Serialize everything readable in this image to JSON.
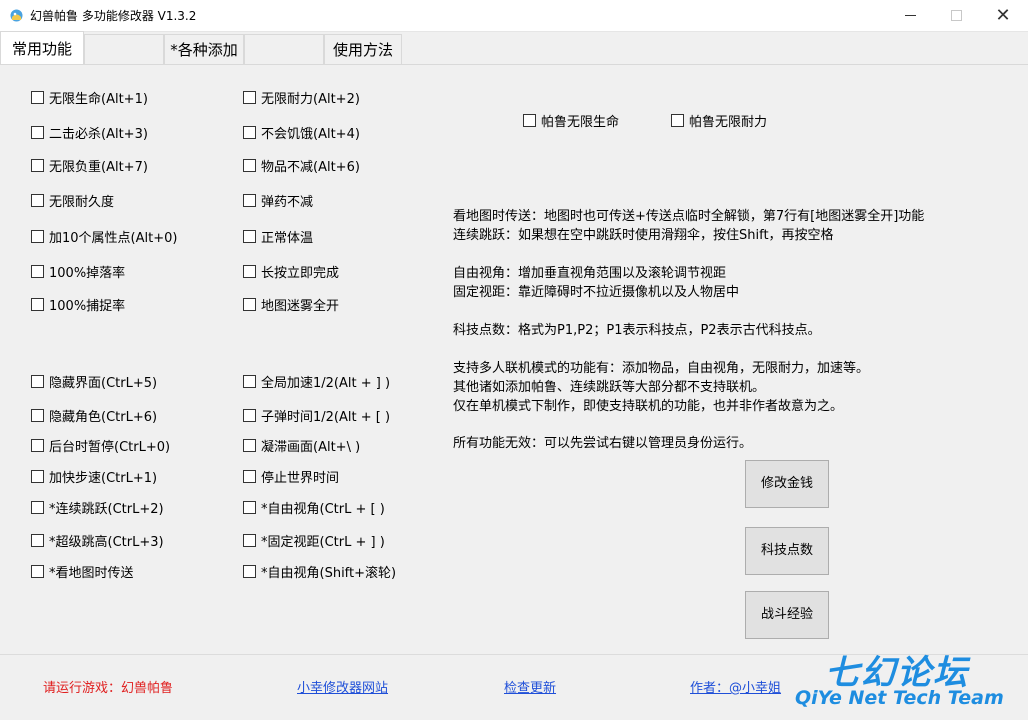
{
  "window": {
    "title": "幻兽帕鲁 多功能修改器  V1.3.2",
    "minimize_icon": "minimize-icon",
    "maximize_icon": "maximize-icon",
    "close_glyph": "✕"
  },
  "tabs": [
    {
      "label": "常用功能"
    },
    {
      "label": ""
    },
    {
      "label": "*各种添加"
    },
    {
      "label": ""
    },
    {
      "label": "使用方法"
    }
  ],
  "checkboxes_col1": [
    "无限生命(Alt+1)",
    "二击必杀(Alt+3)",
    "无限负重(Alt+7)",
    "无限耐久度",
    "加10个属性点(Alt+0)",
    "100%掉落率",
    "100%捕捉率",
    "隐藏界面(CtrL+5)",
    "隐藏角色(CtrL+6)",
    "后台时暂停(CtrL+0)",
    "加快步速(CtrL+1)",
    "*连续跳跃(CtrL+2)",
    "*超级跳高(CtrL+3)",
    "*看地图时传送"
  ],
  "checkboxes_col2": [
    "无限耐力(Alt+2)",
    "不会饥饿(Alt+4)",
    "物品不减(Alt+6)",
    "弹药不减",
    "正常体温",
    "长按立即完成",
    "地图迷雾全开",
    "全局加速1/2(Alt + ] )",
    "子弹时间1/2(Alt + [ )",
    "凝滞画面(Alt+\\ )",
    "停止世界时间",
    "*自由视角(CtrL + [ )",
    "*固定视距(CtrL + ] )",
    "*自由视角(Shift+滚轮)"
  ],
  "pal_checkboxes": [
    "帕鲁无限生命",
    "帕鲁无限耐力"
  ],
  "info_lines": [
    "看地图时传送：地图时也可传送+传送点临时全解锁，第7行有[地图迷雾全开]功能",
    "连续跳跃：如果想在空中跳跃时使用滑翔伞，按住Shift，再按空格",
    "自由视角：增加垂直视角范围以及滚轮调节视距",
    "固定视距：靠近障碍时不拉近摄像机以及人物居中",
    "科技点数：格式为P1,P2；P1表示科技点，P2表示古代科技点。",
    "支持多人联机模式的功能有：添加物品，自由视角，无限耐力，加速等。",
    "其他诸如添加帕鲁、连续跳跃等大部分都不支持联机。",
    "仅在单机模式下制作，即使支持联机的功能，也并非作者故意为之。",
    "所有功能无效：可以先尝试右键以管理员身份运行。"
  ],
  "buttons": [
    "修改金钱",
    "科技点数",
    "战斗经验"
  ],
  "footer": {
    "run_game": "请运行游戏：幻兽帕鲁",
    "site_link": "小幸修改器网站",
    "update_link": "检查更新",
    "author_link": "作者：@小幸姐"
  },
  "watermark": {
    "cn": "七幻论坛",
    "en": "QiYe Net Tech Team"
  },
  "colors": {
    "accent_red": "#e02020",
    "link_blue": "#1f4fd8",
    "watermark_blue": "#1e8de0"
  }
}
